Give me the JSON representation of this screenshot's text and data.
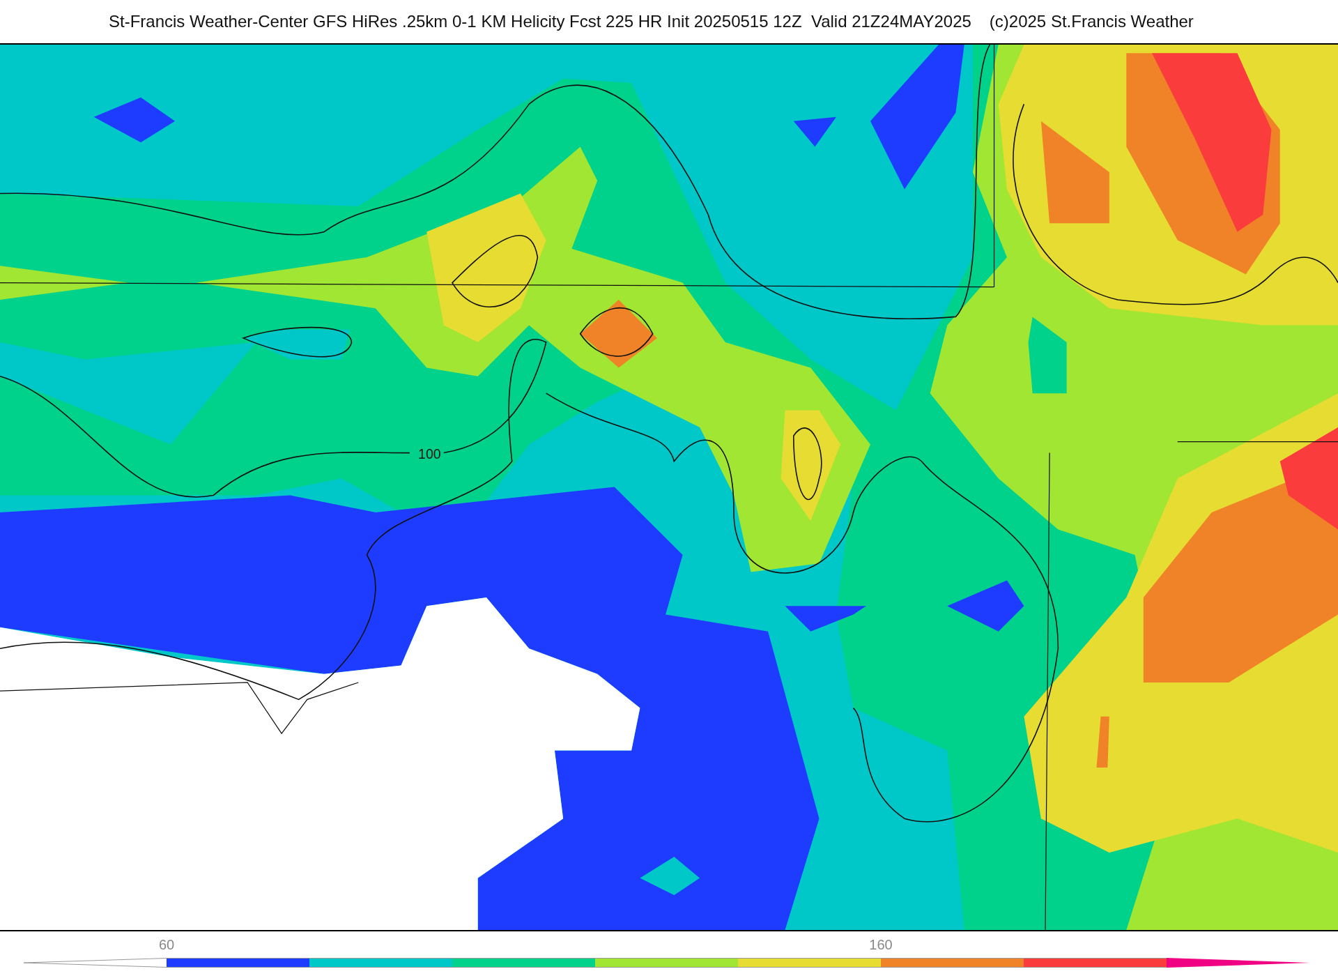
{
  "header": {
    "title": "St-Francis Weather-Center GFS HiRes .25km 0-1 KM Helicity Fcst 225 HR Init 20250515 12Z  Valid 21Z24MAY2025",
    "credit": "(c)2025 St.Francis Weather"
  },
  "map": {
    "contour_label": "100"
  },
  "colorbar": {
    "segments": [
      {
        "kind": "under",
        "color": "#ffffff"
      },
      {
        "kind": "band",
        "color": "#1e3cff",
        "label": "60"
      },
      {
        "kind": "band",
        "color": "#00c8c8"
      },
      {
        "kind": "band",
        "color": "#00d28c"
      },
      {
        "kind": "band",
        "color": "#a0e632"
      },
      {
        "kind": "band",
        "color": "#e6dc32"
      },
      {
        "kind": "band",
        "color": "#f08228",
        "label": "160"
      },
      {
        "kind": "band",
        "color": "#fa3c3c"
      },
      {
        "kind": "over",
        "color": "#f00082"
      }
    ]
  }
}
